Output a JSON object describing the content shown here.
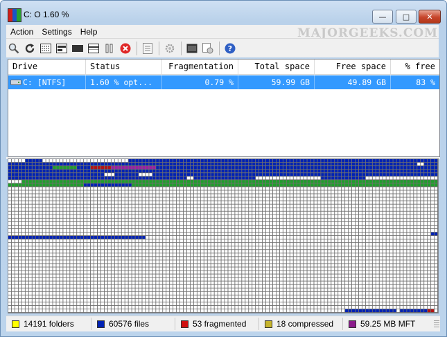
{
  "window": {
    "title": "C:  O  1.60 %",
    "watermark": "MAJORGEEKS.COM"
  },
  "menu": [
    {
      "label": "Action"
    },
    {
      "label": "Settings"
    },
    {
      "label": "Help"
    }
  ],
  "toolbar": [
    {
      "icon": "analyze-icon"
    },
    {
      "icon": "refresh-icon"
    },
    {
      "icon": "defrag-icon"
    },
    {
      "icon": "quick-optimize-icon"
    },
    {
      "icon": "mft-optimize-icon"
    },
    {
      "icon": "full-optimize-icon"
    },
    {
      "icon": "pause-icon"
    },
    {
      "icon": "stop-icon"
    },
    {
      "icon": "report-icon"
    },
    {
      "icon": "settings-icon"
    },
    {
      "icon": "boot-time-icon"
    },
    {
      "icon": "script-icon"
    },
    {
      "icon": "help-icon"
    }
  ],
  "drives": {
    "columns": [
      "Drive",
      "Status",
      "Fragmentation",
      "Total space",
      "Free space",
      "% free"
    ],
    "rows": [
      {
        "drive": "C: [NTFS]",
        "status": "1.60 % opt...",
        "fragmentation": "0.79 %",
        "total": "59.99 GB",
        "free": "49.89 GB",
        "percent_free": "83 %"
      }
    ]
  },
  "cluster_map": {
    "colors": {
      "empty": "#ffffff",
      "used": "#0022b4",
      "fragmented": "#b41212",
      "mft": "#9b1da4",
      "compressed": "#c6b42c",
      "recent": "#1f9e2b",
      "grid": "#707070"
    }
  },
  "status": [
    {
      "label": "14191 folders",
      "color": "#ffff00"
    },
    {
      "label": "60576 files",
      "color": "#0022b4"
    },
    {
      "label": "53 fragmented",
      "color": "#d01010"
    },
    {
      "label": "18 compressed",
      "color": "#c6b42c"
    },
    {
      "label": "59.25 MB MFT",
      "color": "#8b1b8b"
    }
  ]
}
